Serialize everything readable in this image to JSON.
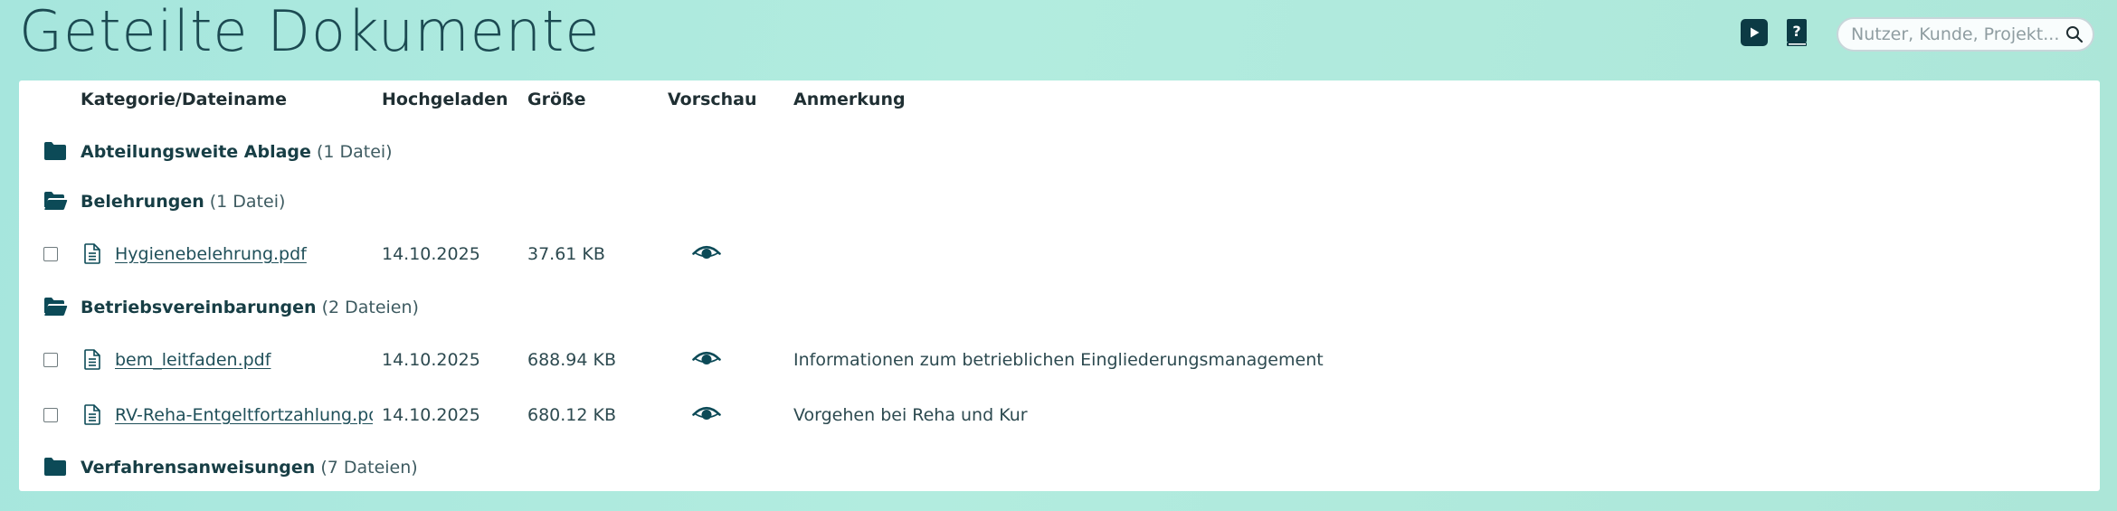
{
  "page": {
    "title": "Geteilte Dokumente",
    "search_placeholder": "Nutzer, Kunde, Projekt..."
  },
  "toolbar": {
    "video_icon": "play-video-icon",
    "help_icon": "help-book-icon"
  },
  "table": {
    "headers": {
      "name": "Kategorie/Dateiname",
      "uploaded": "Hochgeladen",
      "size": "Größe",
      "preview": "Vorschau",
      "note": "Anmerkung"
    },
    "categories": [
      {
        "name": "Abteilungsweite Ablage",
        "count": "(1 Datei)",
        "state": "collapsed",
        "files": []
      },
      {
        "name": "Belehrungen",
        "count": "(1 Datei)",
        "state": "expanded",
        "files": [
          {
            "name": "Hygienebelehrung.pdf",
            "uploaded": "14.10.2025",
            "size": "37.61 KB",
            "note": ""
          }
        ]
      },
      {
        "name": "Betriebsvereinbarungen",
        "count": "(2 Dateien)",
        "state": "expanded",
        "files": [
          {
            "name": "bem_leitfaden.pdf",
            "uploaded": "14.10.2025",
            "size": "688.94 KB",
            "note": "Informationen zum betrieblichen Eingliederungsmanagement"
          },
          {
            "name": "RV-Reha-Entgeltfortzahlung.pdf",
            "uploaded": "14.10.2025",
            "size": "680.12 KB",
            "note": "Vorgehen bei Reha und Kur"
          }
        ]
      },
      {
        "name": "Verfahrensanweisungen",
        "count": "(7 Dateien)",
        "state": "collapsed",
        "files": []
      }
    ]
  },
  "colors": {
    "accent": "#0c4a57",
    "background": "#aee9dd",
    "panel": "#ffffff"
  }
}
